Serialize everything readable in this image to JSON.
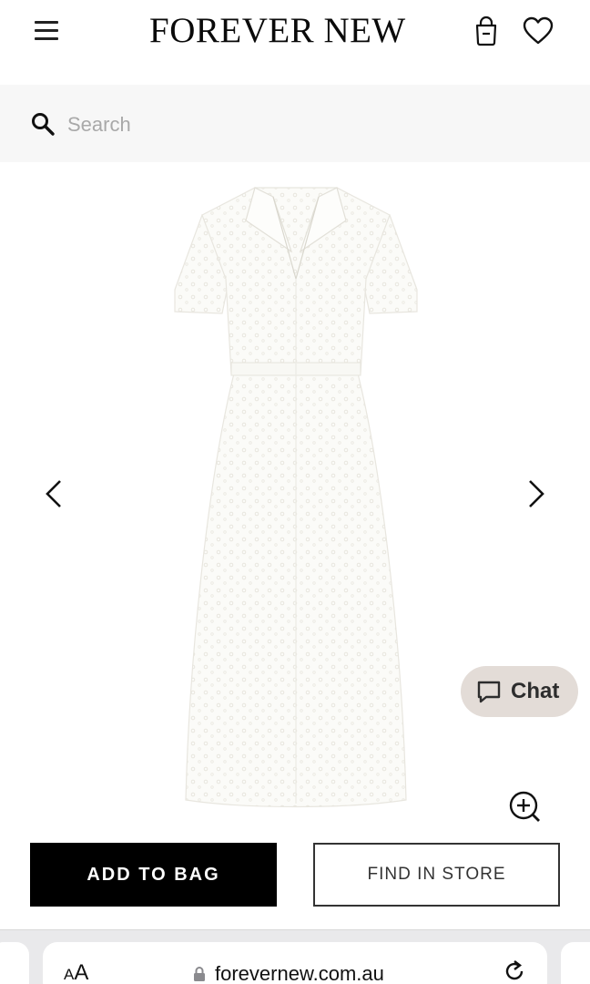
{
  "header": {
    "brand": "FOREVER NEW",
    "menu_icon": "hamburger-menu-icon",
    "bag_icon": "shopping-bag-icon",
    "wishlist_icon": "heart-icon"
  },
  "search": {
    "placeholder": "Search",
    "icon": "search-icon"
  },
  "gallery": {
    "product_image": "white broderie lace shirt dress",
    "prev_icon": "chevron-left-icon",
    "next_icon": "chevron-right-icon",
    "zoom_icon": "zoom-in-icon"
  },
  "chat": {
    "label": "Chat",
    "icon": "chat-bubble-icon",
    "background": "#e3dcd7"
  },
  "actions": {
    "add_to_bag": "ADD TO BAG",
    "find_in_store": "FIND IN STORE"
  },
  "browser": {
    "text_size_small": "A",
    "text_size_large": "A",
    "url": "forevernew.com.au",
    "lock_icon": "lock-icon",
    "reload_icon": "reload-icon"
  },
  "colors": {
    "primary_button": "#000000",
    "search_background": "#f7f7f7",
    "browser_bar": "#e9e9eb"
  }
}
